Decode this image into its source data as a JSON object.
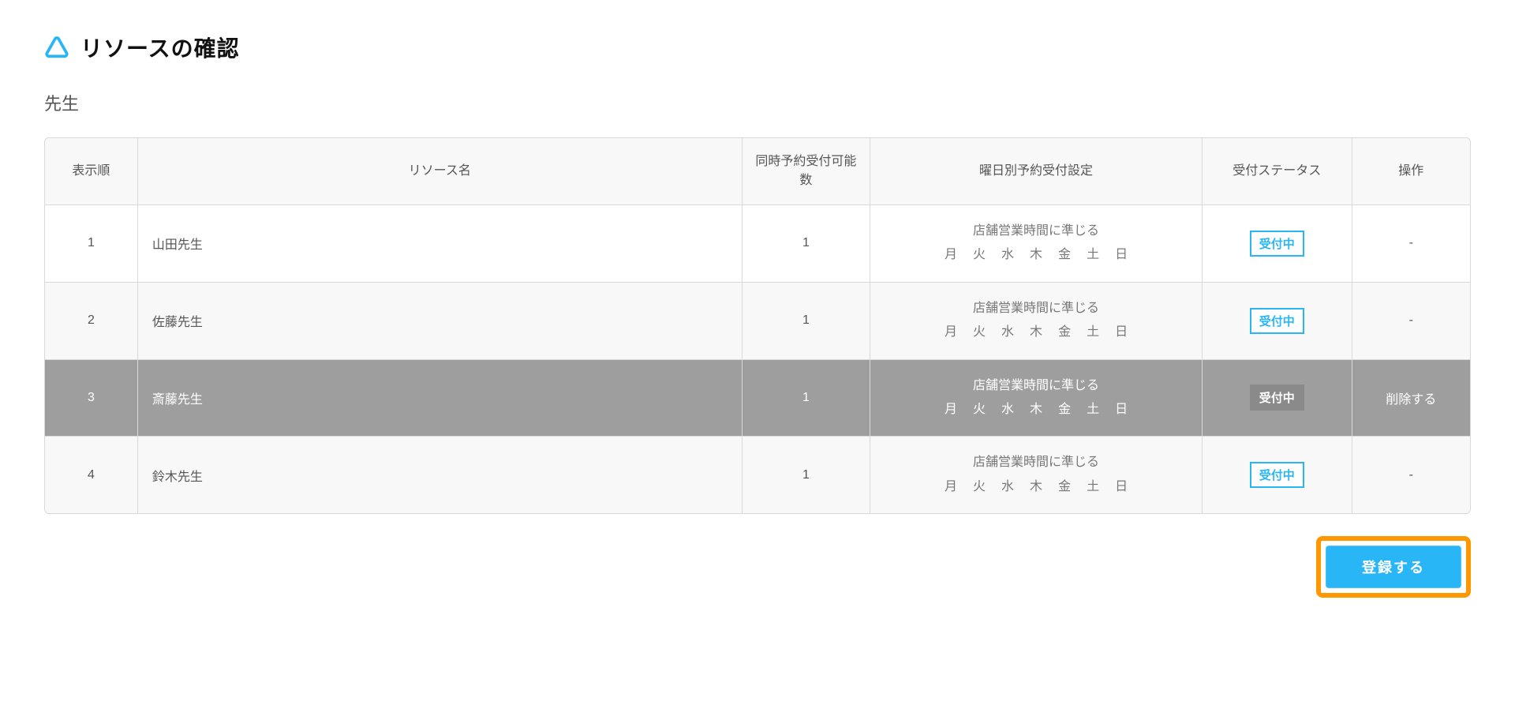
{
  "header": {
    "title": "リソースの確認"
  },
  "section": {
    "title": "先生"
  },
  "table": {
    "columns": {
      "order": "表示順",
      "name": "リソース名",
      "capacity": "同時予約受付可能数",
      "daySetting": "曜日別予約受付設定",
      "status": "受付ステータス",
      "operation": "操作"
    },
    "dayRuleDefault": "店舗営業時間に準じる",
    "days": [
      "月",
      "火",
      "水",
      "木",
      "金",
      "土",
      "日"
    ],
    "rows": [
      {
        "order": "1",
        "name": "山田先生",
        "capacity": "1",
        "status": "受付中",
        "operation": "-",
        "highlight": false
      },
      {
        "order": "2",
        "name": "佐藤先生",
        "capacity": "1",
        "status": "受付中",
        "operation": "-",
        "highlight": false
      },
      {
        "order": "3",
        "name": "斎藤先生",
        "capacity": "1",
        "status": "受付中",
        "operation": "削除する",
        "highlight": true
      },
      {
        "order": "4",
        "name": "鈴木先生",
        "capacity": "1",
        "status": "受付中",
        "operation": "-",
        "highlight": false
      }
    ]
  },
  "actions": {
    "submit": "登録する"
  }
}
